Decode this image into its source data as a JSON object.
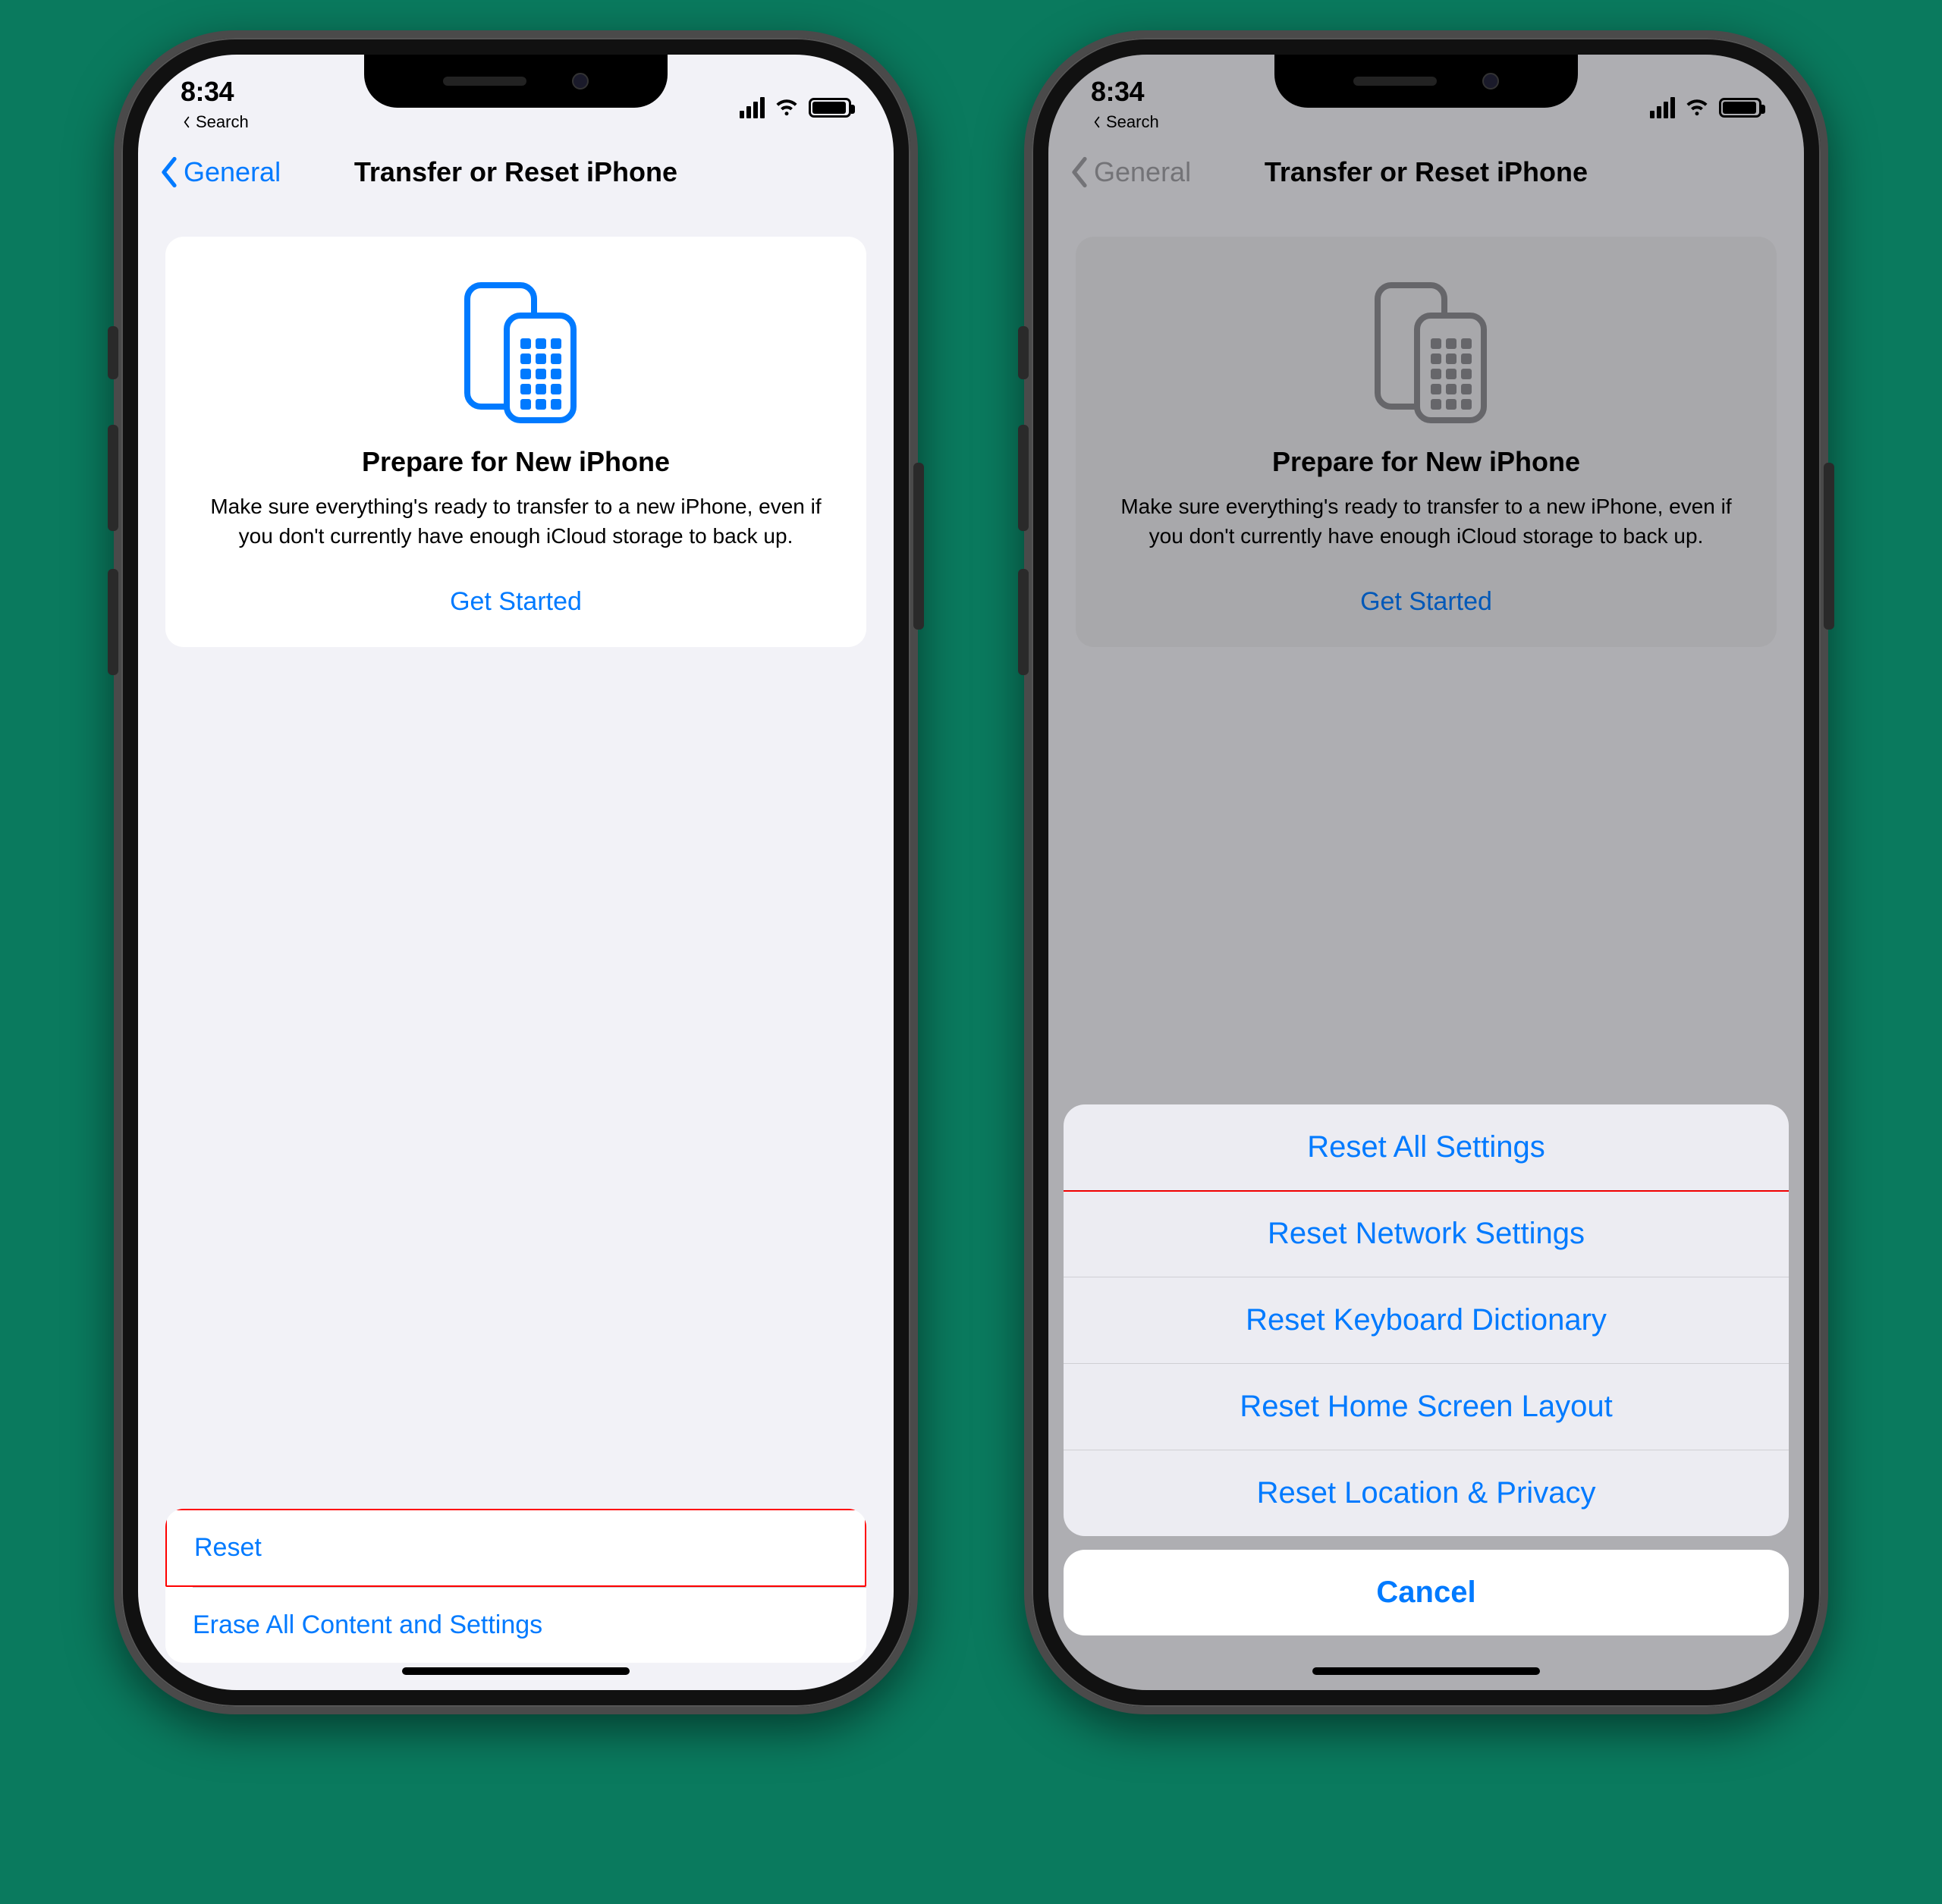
{
  "status": {
    "time": "8:34",
    "back_hint_label": "Search"
  },
  "nav": {
    "back_label": "General",
    "title": "Transfer or Reset iPhone"
  },
  "prepare": {
    "heading": "Prepare for New iPhone",
    "body": "Make sure everything's ready to transfer to a new iPhone, even if you don't currently have enough iCloud storage to back up.",
    "cta": "Get Started"
  },
  "bottom": {
    "reset": "Reset",
    "erase": "Erase All Content and Settings"
  },
  "sheet": {
    "items": [
      "Reset All Settings",
      "Reset Network Settings",
      "Reset Keyboard Dictionary",
      "Reset Home Screen Layout",
      "Reset Location & Privacy"
    ],
    "cancel": "Cancel"
  },
  "colors": {
    "ios_blue": "#007aff",
    "highlight": "#ff0000"
  }
}
